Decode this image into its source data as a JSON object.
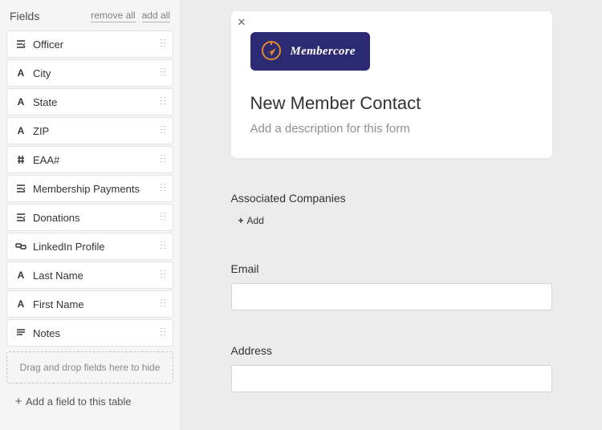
{
  "sidebar": {
    "title": "Fields",
    "remove_all": "remove all",
    "add_all": "add all",
    "dropzone": "Drag and drop fields here to hide",
    "add_field": "Add a field to this table",
    "items": [
      {
        "icon": "filter",
        "label": "Officer"
      },
      {
        "icon": "text",
        "label": "City"
      },
      {
        "icon": "text",
        "label": "State"
      },
      {
        "icon": "text",
        "label": "ZIP"
      },
      {
        "icon": "hash",
        "label": "EAA#"
      },
      {
        "icon": "filter",
        "label": "Membership Payments"
      },
      {
        "icon": "filter",
        "label": "Donations"
      },
      {
        "icon": "link",
        "label": "LinkedIn Profile"
      },
      {
        "icon": "text",
        "label": "Last Name"
      },
      {
        "icon": "text",
        "label": "First Name"
      },
      {
        "icon": "long",
        "label": "Notes"
      }
    ]
  },
  "form": {
    "brand": "Membercore",
    "title": "New Member Contact",
    "description_placeholder": "Add a description for this form",
    "sections": {
      "companies": {
        "label": "Associated Companies",
        "add": "Add"
      },
      "email": {
        "label": "Email",
        "value": ""
      },
      "address": {
        "label": "Address",
        "value": ""
      }
    }
  }
}
